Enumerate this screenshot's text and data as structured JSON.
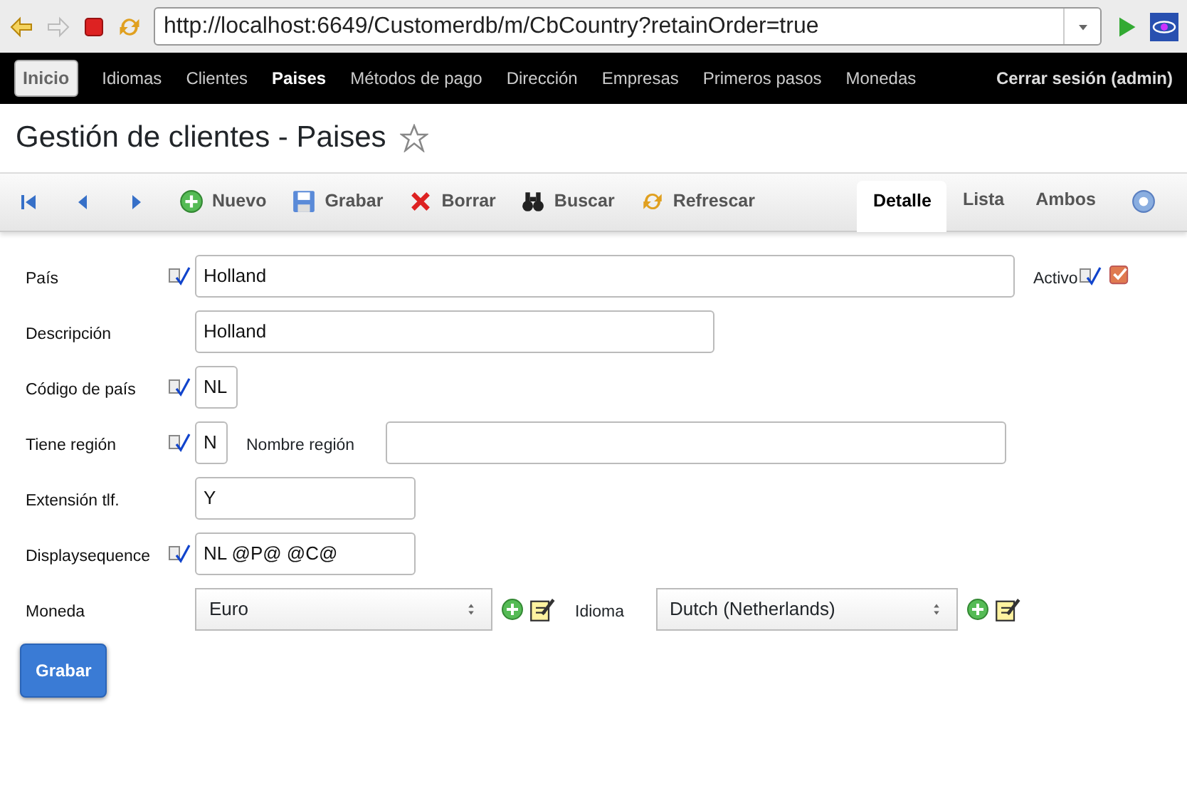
{
  "browser": {
    "url": "http://localhost:6649/Customerdb/m/CbCountry?retainOrder=true",
    "forward_disabled": true
  },
  "nav": {
    "home": "Inicio",
    "items": [
      {
        "label": "Idiomas",
        "selected": false
      },
      {
        "label": "Clientes",
        "selected": false
      },
      {
        "label": "Paises",
        "selected": true
      },
      {
        "label": "Métodos de pago",
        "selected": false
      },
      {
        "label": "Dirección",
        "selected": false
      },
      {
        "label": "Empresas",
        "selected": false
      },
      {
        "label": "Primeros pasos",
        "selected": false
      },
      {
        "label": "Monedas",
        "selected": false
      }
    ],
    "logout": "Cerrar sesión (admin)"
  },
  "page_title": "Gestión de clientes - Paises",
  "toolbar": {
    "actions": [
      {
        "label": "Nuevo",
        "kind": "add"
      },
      {
        "label": "Grabar",
        "kind": "save"
      },
      {
        "label": "Borrar",
        "kind": "delete"
      },
      {
        "label": "Buscar",
        "kind": "search"
      },
      {
        "label": "Refrescar",
        "kind": "refresh"
      }
    ],
    "tabs": [
      {
        "label": "Detalle",
        "selected": true
      },
      {
        "label": "Lista",
        "selected": false
      },
      {
        "label": "Ambos",
        "selected": false
      }
    ]
  },
  "form": {
    "rows": [
      {
        "fields": [
          {
            "label": "País",
            "required": true,
            "value": "Holland",
            "kind": "text"
          },
          {
            "label": "Activo",
            "required": true,
            "checked": true,
            "kind": "checkbox"
          }
        ]
      },
      {
        "fields": [
          {
            "label": "Descripción",
            "required": false,
            "value": "Holland",
            "kind": "text"
          }
        ]
      },
      {
        "fields": [
          {
            "label": "Código de país",
            "required": true,
            "value": "NL",
            "kind": "text"
          }
        ]
      },
      {
        "fields": [
          {
            "label": "Tiene región",
            "required": true,
            "value": "N",
            "kind": "text"
          },
          {
            "label": "Nombre región",
            "kind": "text"
          }
        ]
      },
      {
        "fields": [
          {
            "label": "Extensión tlf.",
            "required": false,
            "value": "Y",
            "kind": "text"
          }
        ]
      },
      {
        "fields": [
          {
            "label": "Displaysequence",
            "required": true,
            "value": "NL @P@ @C@",
            "kind": "text"
          }
        ]
      },
      {
        "fields": [
          {
            "label": "Moneda",
            "value": "Euro",
            "kind": "select"
          },
          {
            "label": "Idioma",
            "value": "Dutch (Netherlands)",
            "kind": "select"
          }
        ]
      }
    ],
    "submit": "Grabar"
  }
}
